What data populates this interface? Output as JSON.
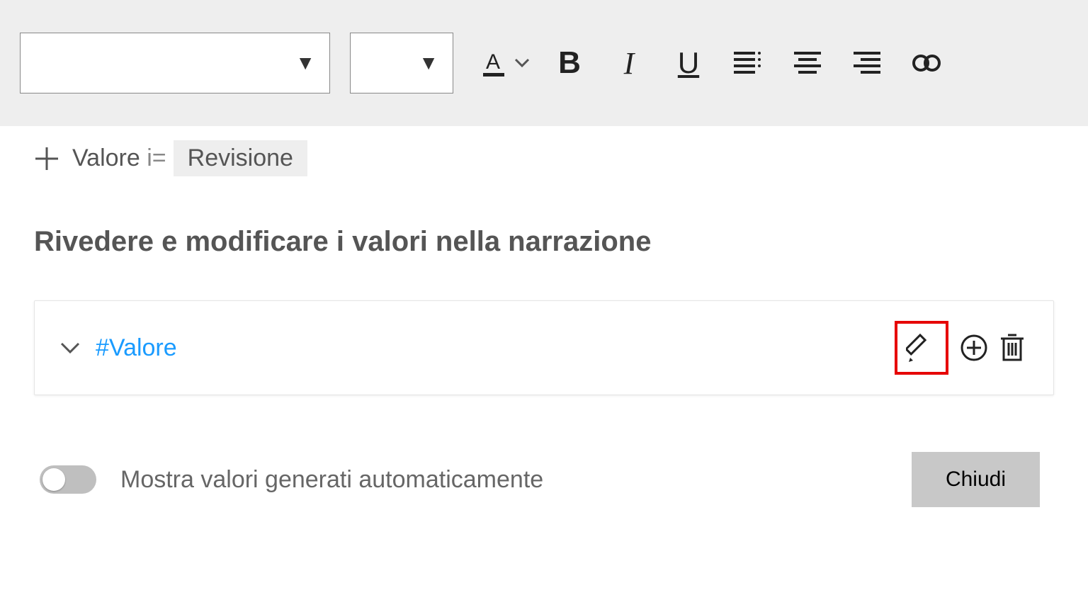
{
  "toolbar": {
    "font_select": "",
    "size_select": ""
  },
  "tabs": {
    "value_label": "Valore",
    "review_label": "Revisione"
  },
  "heading": "Rivedere e modificare i valori nella narrazione",
  "value_item": {
    "label": "#Valore"
  },
  "footer": {
    "toggle_label": "Mostra valori generati automaticamente",
    "close_label": "Chiudi"
  }
}
